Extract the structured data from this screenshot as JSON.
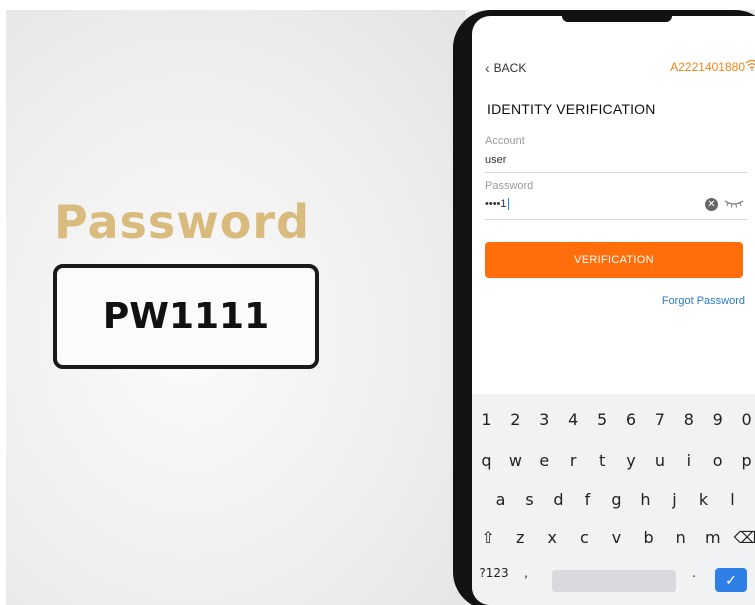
{
  "overlay": {
    "heading": "Password",
    "value": "PW1111"
  },
  "app": {
    "back_label": "BACK",
    "device_id": "A2221401880",
    "title": "IDENTITY VERIFICATION",
    "account": {
      "label": "Account",
      "value": "user"
    },
    "password": {
      "label": "Password",
      "value": "••••1"
    },
    "verify_button": "VERIFICATION",
    "forgot_link": "Forgot Password"
  },
  "keyboard": {
    "numbers": [
      "1",
      "2",
      "3",
      "4",
      "5",
      "6",
      "7",
      "8",
      "9",
      "0"
    ],
    "row1": [
      "q",
      "w",
      "e",
      "r",
      "t",
      "y",
      "u",
      "i",
      "o",
      "p"
    ],
    "row2": [
      "a",
      "s",
      "d",
      "f",
      "g",
      "h",
      "j",
      "k",
      "l"
    ],
    "row3": [
      "z",
      "x",
      "c",
      "v",
      "b",
      "n",
      "m"
    ],
    "mode_key": "?123",
    "comma_key": ",",
    "period_key": ".",
    "shift_icon": "⇧",
    "backspace_icon": "⌫",
    "enter_icon": "✓"
  },
  "colors": {
    "accent": "#ff6e0a",
    "device_id": "#f0841e",
    "link": "#2b78c7",
    "heading_gold": "#d8bb7d"
  }
}
